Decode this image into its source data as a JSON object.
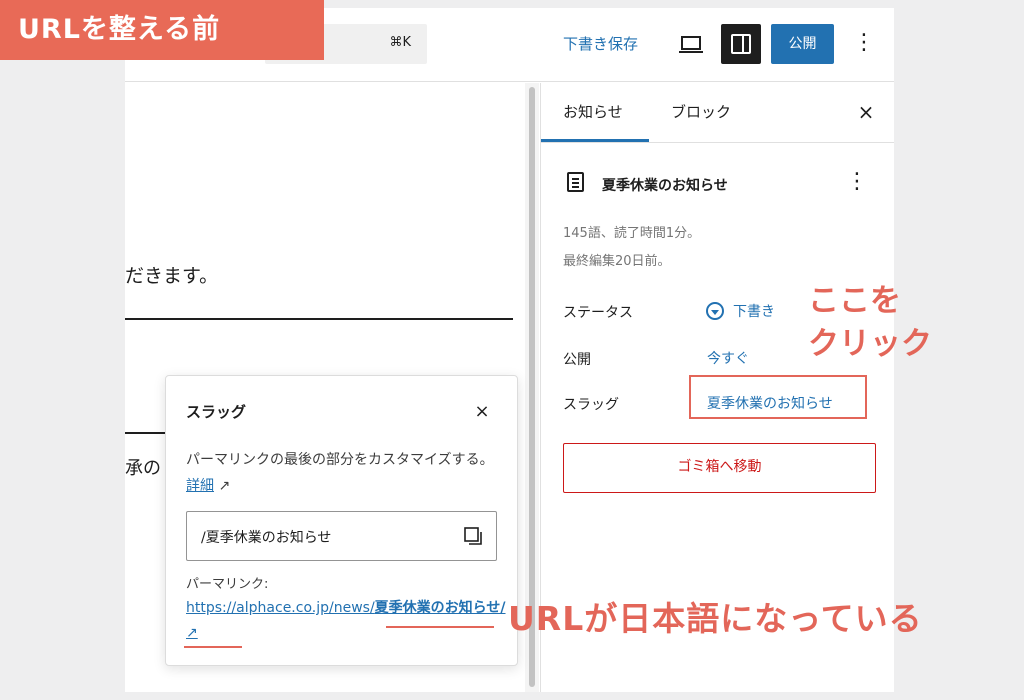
{
  "toolbar": {
    "command_shortcut": "⌘K",
    "save_draft": "下書き保存",
    "publish": "公開",
    "options": "⋮"
  },
  "editor": {
    "text_line_1": "だきます。",
    "text_line_2": "承の"
  },
  "sidebar": {
    "tabs": [
      {
        "label": "お知らせ",
        "active": true
      },
      {
        "label": "ブロック",
        "active": false
      }
    ],
    "close": "×",
    "post_title": "夏季休業のお知らせ",
    "post_more": "⋮",
    "meta": [
      "145語、読了時間1分。",
      "最終編集20日前。"
    ],
    "rows": [
      {
        "label": "ステータス",
        "value": "下書き"
      },
      {
        "label": "公開",
        "value": "今すぐ"
      },
      {
        "label": "スラッグ",
        "value": "夏季休業のお知らせ"
      }
    ],
    "trash": "ゴミ箱へ移動"
  },
  "popover": {
    "title": "スラッグ",
    "close": "×",
    "help_text": "パーマリンクの最後の部分をカスタマイズする。",
    "help_link": "詳細",
    "slug_value": "/夏季休業のお知らせ",
    "permalink_label": "パーマリンク:",
    "permalink_base": "https://alphace.co.jp/news/",
    "permalink_slug": "夏季休業のお知らせ/"
  },
  "annotations": {
    "corner_label": "URLを整える前",
    "click_line_1": "ここを",
    "click_line_2": "クリック",
    "url_note": "URLが日本語になっている",
    "color": "#e36659"
  },
  "colors": {
    "accent": "#2271b1",
    "danger": "#cc1818",
    "annotation": "#e36659"
  }
}
